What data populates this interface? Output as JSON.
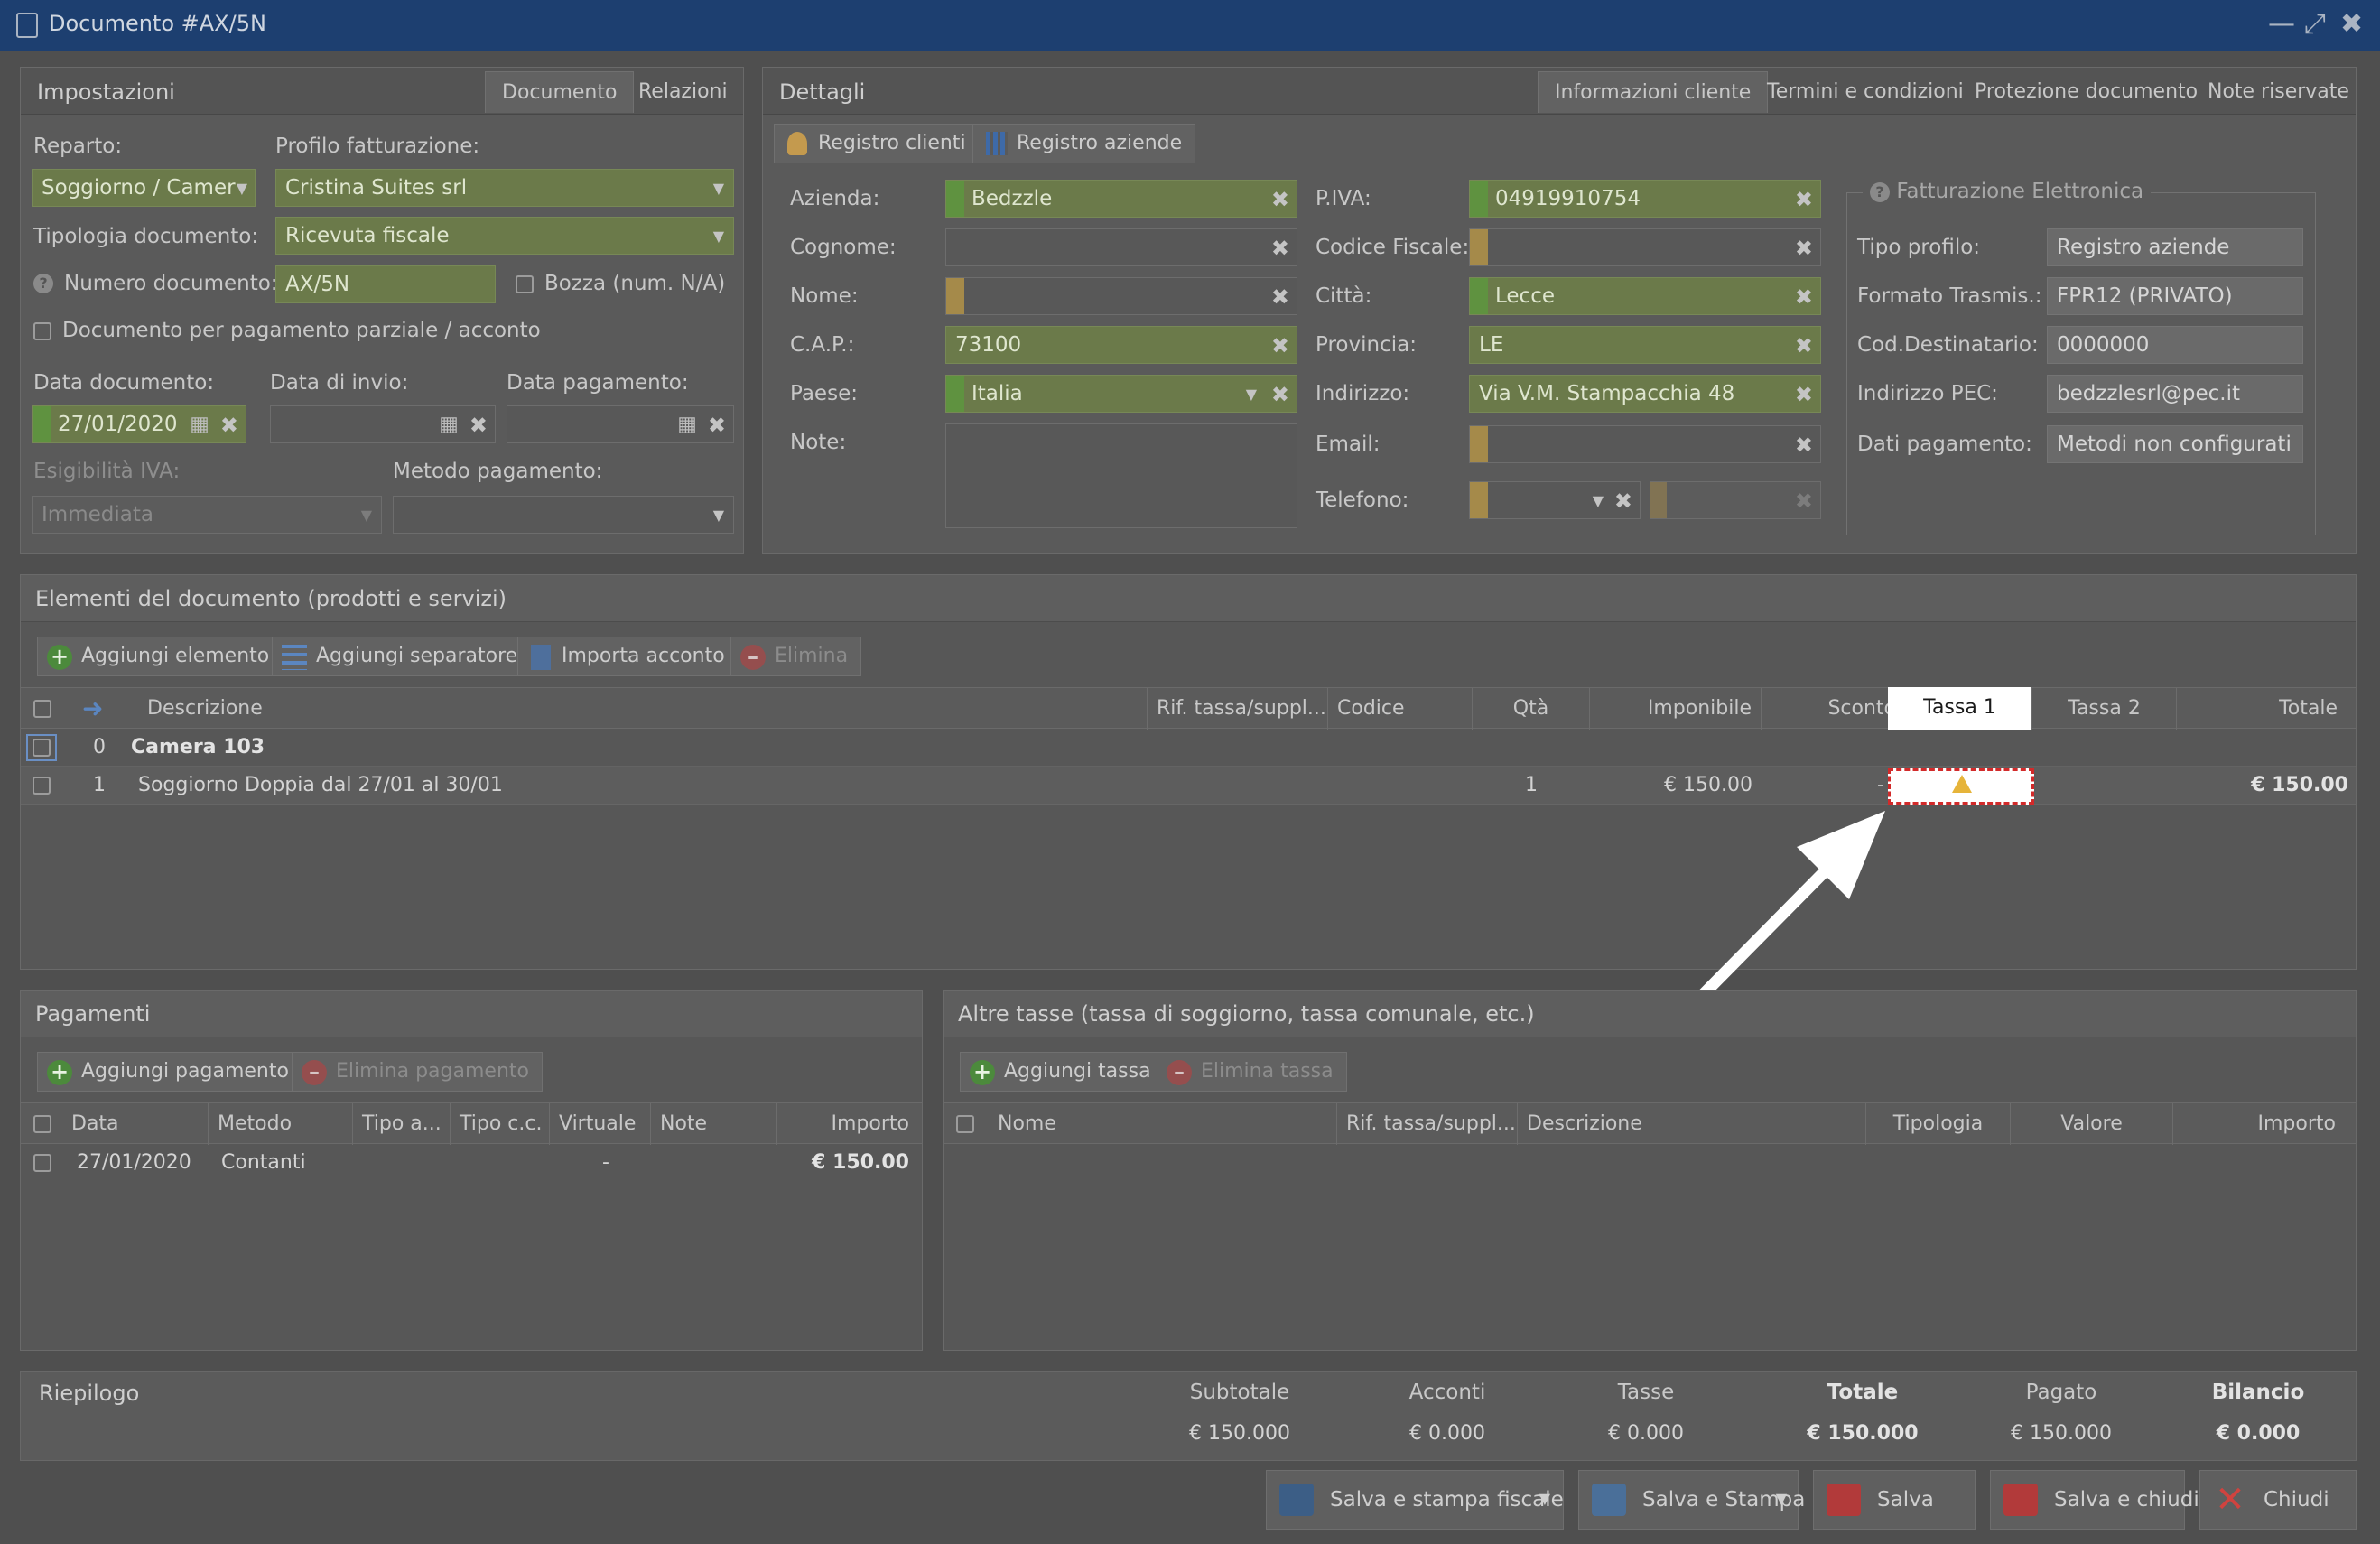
{
  "window": {
    "title": "Documento #AX/5N"
  },
  "settings": {
    "title": "Impostazioni",
    "tabs": [
      "Documento",
      "Relazioni"
    ],
    "reparto_label": "Reparto:",
    "reparto_value": "Soggiorno / Camer",
    "profilo_label": "Profilo fatturazione:",
    "profilo_value": "Cristina Suites srl",
    "tipologia_label": "Tipologia documento:",
    "tipologia_value": "Ricevuta fiscale",
    "numero_label": "Numero documento:",
    "numero_value": "AX/5N",
    "bozza_label": "Bozza (num. N/A)",
    "parziale_label": "Documento per pagamento parziale / acconto",
    "data_doc_label": "Data documento:",
    "data_doc_value": "27/01/2020",
    "data_invio_label": "Data di invio:",
    "data_pag_label": "Data pagamento:",
    "esigibilita_label": "Esigibilità IVA:",
    "esigibilita_value": "Immediata",
    "metodo_label": "Metodo pagamento:"
  },
  "details": {
    "title": "Dettagli",
    "tabs": [
      "Informazioni cliente",
      "Termini e condizioni",
      "Protezione documento",
      "Note riservate"
    ],
    "btn_clienti": "Registro clienti",
    "btn_aziende": "Registro aziende",
    "azienda_label": "Azienda:",
    "azienda_value": "Bedzzle",
    "cognome_label": "Cognome:",
    "nome_label": "Nome:",
    "cap_label": "C.A.P.:",
    "cap_value": "73100",
    "paese_label": "Paese:",
    "paese_value": "Italia",
    "note_label": "Note:",
    "piva_label": "P.IVA:",
    "piva_value": "04919910754",
    "cf_label": "Codice Fiscale:",
    "citta_label": "Città:",
    "citta_value": "Lecce",
    "provincia_label": "Provincia:",
    "provincia_value": "LE",
    "indirizzo_label": "Indirizzo:",
    "indirizzo_value": "Via V.M. Stampacchia 48",
    "email_label": "Email:",
    "telefono_label": "Telefono:"
  },
  "einvoice": {
    "title": "Fatturazione Elettronica",
    "rows": [
      {
        "label": "Tipo profilo:",
        "value": "Registro aziende"
      },
      {
        "label": "Formato Trasmis.:",
        "value": "FPR12 (PRIVATO)"
      },
      {
        "label": "Cod.Destinatario:",
        "value": "0000000"
      },
      {
        "label": "Indirizzo PEC:",
        "value": "bedzzlesrl@pec.it"
      },
      {
        "label": "Dati pagamento:",
        "value": "Metodi non configurati"
      }
    ]
  },
  "items": {
    "title": "Elementi del documento (prodotti e servizi)",
    "btn_add": "Aggiungi elemento",
    "btn_sep": "Aggiungi separatore",
    "btn_import": "Importa acconto",
    "btn_delete": "Elimina",
    "columns": [
      "Descrizione",
      "Rif. tassa/suppl...",
      "Codice",
      "Qtà",
      "Imponibile",
      "Sconto",
      "Tassa 1",
      "Tassa 2",
      "Totale"
    ],
    "group_index": "0",
    "group_name": "Camera 103",
    "row_index": "1",
    "row_desc": "Soggiorno Doppia dal 27/01 al 30/01",
    "row_qty": "1",
    "row_imponibile": "€ 150.00",
    "row_sconto": "-",
    "row_totale": "€ 150.00"
  },
  "payments": {
    "title": "Pagamenti",
    "btn_add": "Aggiungi pagamento",
    "btn_delete": "Elimina pagamento",
    "columns": [
      "Data",
      "Metodo",
      "Tipo a...",
      "Tipo c.c.",
      "Virtuale",
      "Note",
      "Importo"
    ],
    "row": {
      "data": "27/01/2020",
      "metodo": "Contanti",
      "virtuale": "-",
      "importo": "€ 150.00"
    }
  },
  "taxes": {
    "title": "Altre tasse (tassa di soggiorno, tassa comunale, etc.)",
    "btn_add": "Aggiungi tassa",
    "btn_delete": "Elimina tassa",
    "columns": [
      "Nome",
      "Rif. tassa/suppl...",
      "Descrizione",
      "Tipologia",
      "Valore",
      "Importo"
    ]
  },
  "summary": {
    "title": "Riepilogo",
    "cols": [
      {
        "label": "Subtotale",
        "value": "€ 150.000"
      },
      {
        "label": "Acconti",
        "value": "€ 0.000"
      },
      {
        "label": "Tasse",
        "value": "€ 0.000"
      },
      {
        "label": "Totale",
        "value": "€ 150.000"
      },
      {
        "label": "Pagato",
        "value": "€ 150.000"
      },
      {
        "label": "Bilancio",
        "value": "€ 0.000"
      }
    ]
  },
  "footer": {
    "btn_fiscale": "Salva e stampa fiscale",
    "btn_stampa": "Salva e Stampa",
    "btn_salva": "Salva",
    "btn_chiudi_salva": "Salva e chiudi",
    "btn_chiudi": "Chiudi"
  }
}
